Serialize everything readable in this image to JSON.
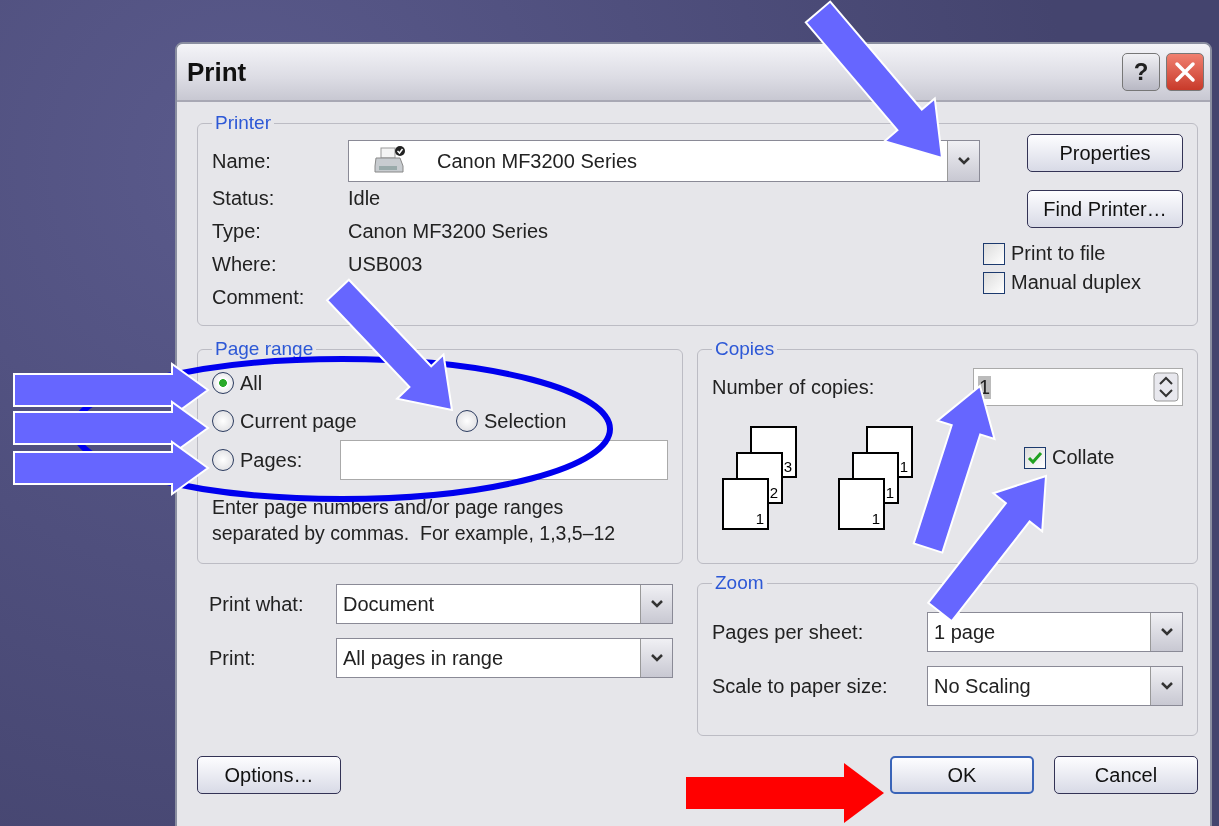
{
  "window": {
    "title": "Print",
    "help_button": "?"
  },
  "printer": {
    "legend": "Printer",
    "name_label": "Name:",
    "name_value": "Canon MF3200 Series",
    "info": [
      {
        "label": "Status:",
        "value": "Idle"
      },
      {
        "label": "Type:",
        "value": "Canon MF3200 Series"
      },
      {
        "label": "Where:",
        "value": "USB003"
      },
      {
        "label": "Comment:"
      }
    ],
    "buttons": [
      "Properties",
      "Find Printer…"
    ],
    "options": [
      {
        "label": "Print to file",
        "checked": false
      },
      {
        "label": "Manual duplex",
        "checked": false
      }
    ]
  },
  "page_range": {
    "legend": "Page range",
    "options": [
      {
        "label": "All",
        "selected": true
      },
      {
        "label": "Current page",
        "selected": false
      },
      {
        "label": "Selection",
        "selected": false
      },
      {
        "label": "Pages:",
        "selected": false
      }
    ],
    "hint": "Enter page numbers and/or page ranges separated by commas.  For example, 1,3,5–12"
  },
  "copies": {
    "legend": "Copies",
    "label": "Number of copies:",
    "value": "1",
    "collated_pages": [
      "1",
      "2",
      "3"
    ],
    "uncollated_pages": [
      "1",
      "1",
      "1"
    ],
    "collate": {
      "label": "Collate",
      "checked": true
    }
  },
  "print_what": {
    "label": "Print what:",
    "value": "Document"
  },
  "print": {
    "label": "Print:",
    "value": "All pages in range"
  },
  "zoom": {
    "legend": "Zoom",
    "rows": [
      {
        "label": "Pages per sheet:",
        "value": "1 page"
      },
      {
        "label": "Scale to paper size:",
        "value": "No Scaling"
      }
    ]
  },
  "buttons": [
    {
      "label": "Options…",
      "kind": "secondary"
    },
    {
      "label": "OK",
      "kind": "default"
    },
    {
      "label": "Cancel",
      "kind": "secondary"
    }
  ]
}
